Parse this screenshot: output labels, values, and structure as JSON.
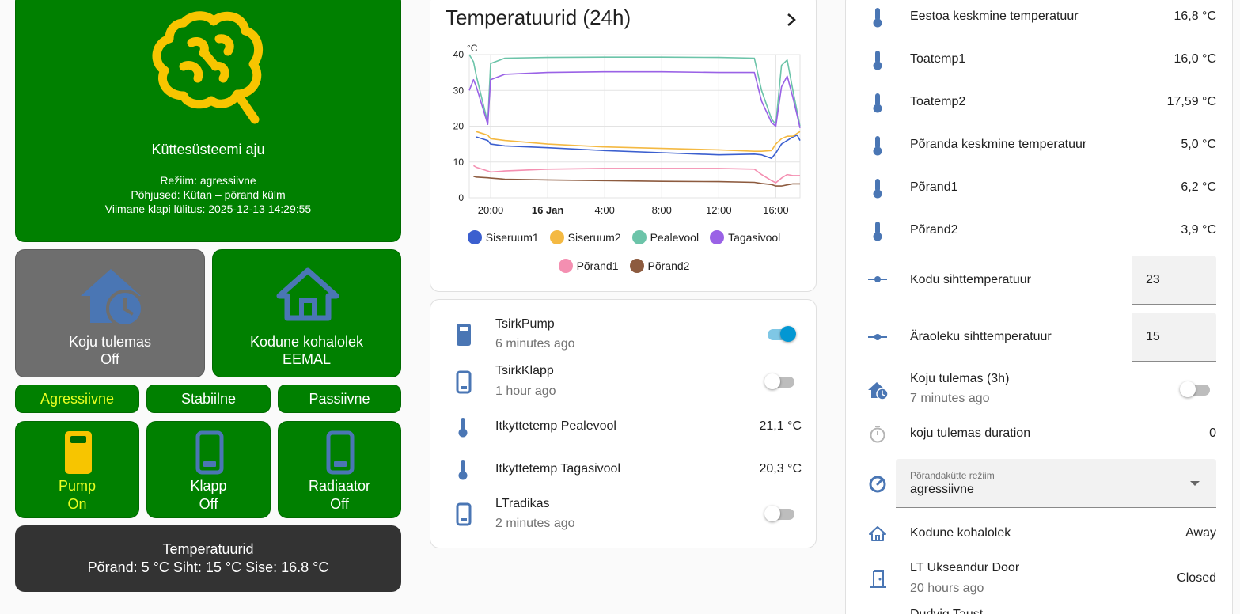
{
  "brain": {
    "title": "Küttesüsteemi aju",
    "mode_line": "Režiim: agressiivne",
    "reason_line": "Põhjused: Kütan – põrand külm",
    "last_valve_line": "Viimane klapi lülitus: 2025-12-13 14:29:55",
    "icon": "brain-icon"
  },
  "tiles": {
    "coming_home": {
      "label": "Koju tulemas",
      "state": "Off",
      "icon": "home-clock-icon"
    },
    "presence": {
      "label": "Kodune kohalolek",
      "state": "EEMAL",
      "icon": "home-outline-icon"
    }
  },
  "mode_buttons": [
    "Agressiivne",
    "Stabiilne",
    "Passiivne"
  ],
  "devices": [
    {
      "label": "Pump",
      "state": "On",
      "icon": "valve-open-icon"
    },
    {
      "label": "Klapp",
      "state": "Off",
      "icon": "valve-closed-icon"
    },
    {
      "label": "Radiaator",
      "state": "Off",
      "icon": "valve-closed-icon"
    }
  ],
  "temps_summary": {
    "title": "Temperatuurid",
    "line": "Põrand: 5 °C Siht: 15 °C Sise: 16.8 °C"
  },
  "chart_card": {
    "title": "Temperatuurid (24h)"
  },
  "chart_data": {
    "type": "line",
    "ylabel": "°C",
    "ylim": [
      0,
      40
    ],
    "yticks": [
      "0",
      "10",
      "20",
      "30",
      "40"
    ],
    "xticks": [
      "20:00",
      "16 Jan",
      "4:00",
      "8:00",
      "12:00",
      "16:00"
    ],
    "x_hours": [
      18.5,
      18.8,
      19.0,
      19.8,
      20.0,
      21.0,
      24.0,
      28.0,
      32.0,
      36.0,
      38.5,
      39.0,
      39.7,
      40.0,
      40.4,
      40.8,
      41.2,
      41.5,
      41.7
    ],
    "series": [
      {
        "name": "Siseruum1",
        "color": "#3b5fcf",
        "values": [
          null,
          null,
          17.0,
          16.0,
          15.0,
          14.5,
          14.0,
          13.2,
          12.6,
          12.0,
          12.2,
          12.0,
          11.0,
          12.5,
          15.0,
          16.0,
          17.0,
          17.5,
          16.0
        ]
      },
      {
        "name": "Siseruum2",
        "color": "#f4b942",
        "values": [
          10.5,
          null,
          18.5,
          17.5,
          16.5,
          16.0,
          15.0,
          14.2,
          13.8,
          13.4,
          13.0,
          13.0,
          13.2,
          15.0,
          16.5,
          17.2,
          17.2,
          18.0,
          18.5
        ]
      },
      {
        "name": "Pealevool",
        "color": "#6cc4a9",
        "values": [
          40.0,
          38.0,
          34.0,
          21.0,
          37.5,
          39.0,
          39.2,
          39.3,
          39.3,
          39.2,
          39.0,
          30.0,
          22.0,
          20.5,
          37.0,
          38.5,
          30.0,
          24.0,
          20.0
        ]
      },
      {
        "name": "Tagasivool",
        "color": "#9a62e6",
        "values": [
          30.0,
          33.0,
          31.0,
          20.5,
          33.0,
          34.5,
          35.0,
          35.2,
          35.2,
          35.0,
          35.0,
          27.0,
          21.0,
          20.0,
          31.0,
          34.0,
          28.0,
          23.0,
          19.5
        ]
      },
      {
        "name": "Põrand1",
        "color": "#f48fb1",
        "values": [
          null,
          9.0,
          8.5,
          7.5,
          7.2,
          7.5,
          8.0,
          8.2,
          8.2,
          8.2,
          8.0,
          6.5,
          4.8,
          4.2,
          5.5,
          6.5,
          6.2,
          6.2,
          6.2
        ]
      },
      {
        "name": "Põrand2",
        "color": "#8d5b3f",
        "values": [
          null,
          6.0,
          5.8,
          5.6,
          5.5,
          5.2,
          5.0,
          4.8,
          4.6,
          4.5,
          4.3,
          4.0,
          3.7,
          3.3,
          3.3,
          3.6,
          3.9,
          3.9,
          3.9
        ]
      }
    ]
  },
  "entities_card": [
    {
      "name": "TsirkPump",
      "sub": "6 minutes ago",
      "type": "toggle",
      "on": true,
      "icon": "valve-icon"
    },
    {
      "name": "TsirkKlapp",
      "sub": "1 hour ago",
      "type": "toggle",
      "on": false,
      "icon": "valve-outline-icon"
    },
    {
      "name": "Itkyttetemp Pealevool",
      "value": "21,1 °C",
      "type": "value",
      "icon": "thermometer-icon"
    },
    {
      "name": "Itkyttetemp Tagasivool",
      "value": "20,3 °C",
      "type": "value",
      "icon": "thermometer-icon"
    },
    {
      "name": "LTradikas",
      "sub": "2 minutes ago",
      "type": "toggle",
      "on": false,
      "icon": "valve-outline-icon"
    }
  ],
  "right_panel": {
    "temps": [
      {
        "name": "Eestoa keskmine temperatuur",
        "value": "16,8 °C"
      },
      {
        "name": "Toatemp1",
        "value": "16,0 °C"
      },
      {
        "name": "Toatemp2",
        "value": "17,59 °C"
      },
      {
        "name": "Põranda keskmine temperatuur",
        "value": "5,0 °C"
      },
      {
        "name": "Põrand1",
        "value": "6,2 °C"
      },
      {
        "name": "Põrand2",
        "value": "3,9 °C"
      }
    ],
    "home_target": {
      "name": "Kodu sihttemperatuur",
      "value": "23"
    },
    "away_target": {
      "name": "Äraoleku sihttemperatuur",
      "value": "15"
    },
    "coming_home": {
      "name": "Koju tulemas (3h)",
      "sub": "7 minutes ago"
    },
    "duration": {
      "name": "koju tulemas duration",
      "value": "0"
    },
    "floor_mode": {
      "label": "Põrandakütte režiim",
      "value": "agressiivne"
    },
    "presence": {
      "name": "Kodune kohalolek",
      "value": "Away"
    },
    "door": {
      "name": "LT Ukseandur Door",
      "sub": "20 hours ago",
      "value": "Closed"
    },
    "cut_off": "Dudvig Taust"
  }
}
